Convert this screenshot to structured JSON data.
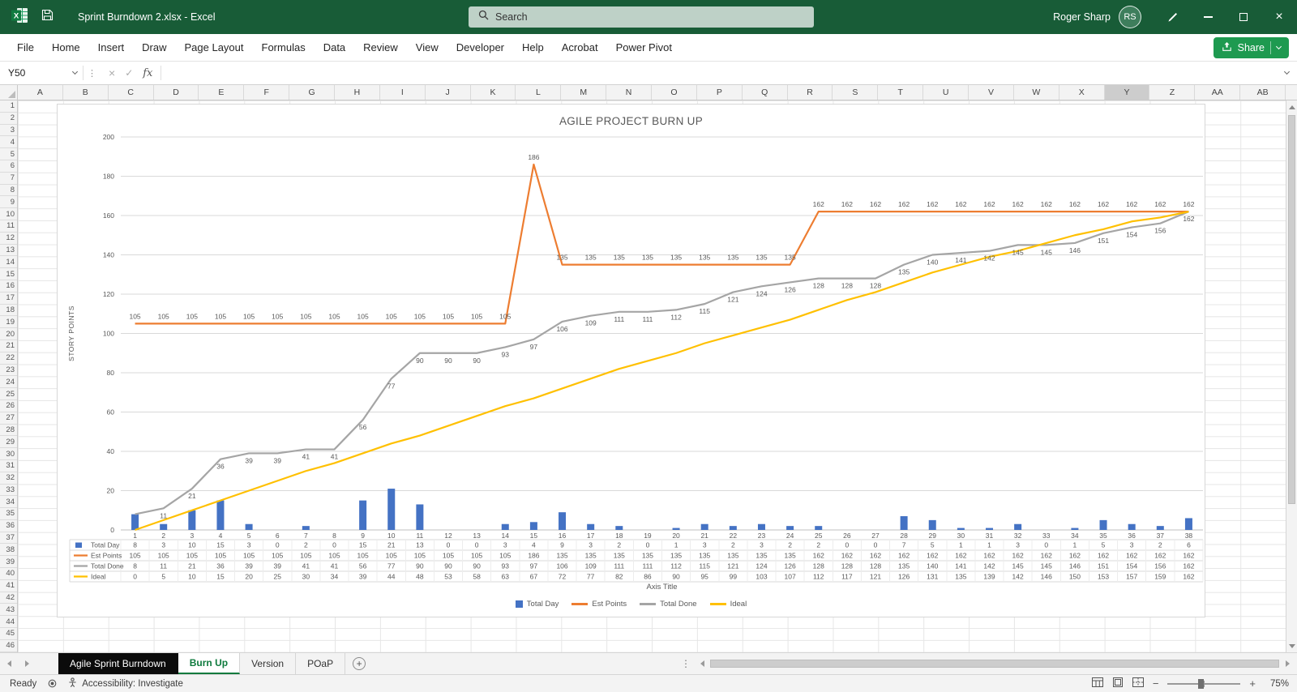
{
  "colors": {
    "titlebar_green": "#185C37",
    "accent_green": "#107C41",
    "share_button_green": "#1E9A50",
    "active_tab_green": "#0E7A3D"
  },
  "title_bar": {
    "document_title": "Sprint Burndown 2.xlsx - Excel",
    "search_placeholder": "Search",
    "user_name": "Roger Sharp",
    "user_initials": "RS"
  },
  "icons": {
    "close": "×",
    "cancel": "×",
    "confirm": "✓",
    "function": "fx",
    "dots": "⋮",
    "new_sheet": "+",
    "zoom_out": "−",
    "zoom_in": "+"
  },
  "ribbon": {
    "tabs": [
      "File",
      "Home",
      "Insert",
      "Draw",
      "Page Layout",
      "Formulas",
      "Data",
      "Review",
      "View",
      "Developer",
      "Help",
      "Acrobat",
      "Power Pivot"
    ],
    "share_label": "Share"
  },
  "formula_bar": {
    "name_box": "Y50",
    "formula_value": ""
  },
  "grid": {
    "columns": [
      "A",
      "B",
      "C",
      "D",
      "E",
      "F",
      "G",
      "H",
      "I",
      "J",
      "K",
      "L",
      "M",
      "N",
      "O",
      "P",
      "Q",
      "R",
      "S",
      "T",
      "U",
      "V",
      "W",
      "X",
      "Y",
      "Z",
      "AA",
      "AB"
    ],
    "selected_column": "Y",
    "rows_start": 1,
    "rows_end": 46
  },
  "sheet_tabs": {
    "tabs": [
      {
        "label": "Agile Sprint Burndown",
        "active": false,
        "dark": true
      },
      {
        "label": "Burn Up",
        "active": true,
        "dark": false
      },
      {
        "label": "Version",
        "active": false,
        "dark": false
      },
      {
        "label": "POaP",
        "active": false,
        "dark": false
      }
    ]
  },
  "status_bar": {
    "ready_label": "Ready",
    "accessibility_label": "Accessibility: Investigate",
    "zoom_level": "75%"
  },
  "chart_data": {
    "type": "combo",
    "title": "AGILE PROJECT BURN UP",
    "xlabel": "Axis Title",
    "ylabel": "STORY POINTS",
    "ylim": [
      0,
      200
    ],
    "ytick_step": 20,
    "gridlines": true,
    "legend_position": "bottom",
    "data_table": true,
    "categories": [
      1,
      2,
      3,
      4,
      5,
      6,
      7,
      8,
      9,
      10,
      11,
      12,
      13,
      14,
      15,
      16,
      17,
      18,
      19,
      20,
      21,
      22,
      23,
      24,
      25,
      26,
      27,
      28,
      29,
      30,
      31,
      32,
      33,
      34,
      35,
      36,
      37,
      38
    ],
    "series": [
      {
        "name": "Total Day",
        "type": "bar",
        "color": "#4472C4",
        "show_labels": false,
        "values": [
          8,
          3,
          10,
          15,
          3,
          0,
          2,
          0,
          15,
          21,
          13,
          0,
          0,
          3,
          4,
          9,
          3,
          2,
          0,
          1,
          3,
          2,
          3,
          2,
          2,
          0,
          0,
          7,
          5,
          1,
          1,
          3,
          0,
          1,
          5,
          3,
          2,
          6
        ]
      },
      {
        "name": "Est Points",
        "type": "line",
        "color": "#ED7D31",
        "show_labels": true,
        "label_position": "above",
        "values": [
          105,
          105,
          105,
          105,
          105,
          105,
          105,
          105,
          105,
          105,
          105,
          105,
          105,
          105,
          186,
          135,
          135,
          135,
          135,
          135,
          135,
          135,
          135,
          135,
          162,
          162,
          162,
          162,
          162,
          162,
          162,
          162,
          162,
          162,
          162,
          162,
          162,
          162
        ]
      },
      {
        "name": "Total Done",
        "type": "line",
        "color": "#A5A5A5",
        "show_labels": true,
        "label_position": "below",
        "label_skip_first": true,
        "values": [
          8,
          11,
          21,
          36,
          39,
          39,
          41,
          41,
          56,
          77,
          90,
          90,
          90,
          93,
          97,
          106,
          109,
          111,
          111,
          112,
          115,
          121,
          124,
          126,
          128,
          128,
          128,
          135,
          140,
          141,
          142,
          145,
          145,
          146,
          151,
          154,
          156,
          162
        ]
      },
      {
        "name": "Ideal",
        "type": "line",
        "color": "#FFC000",
        "show_labels": false,
        "values": [
          0,
          5,
          10,
          15,
          20,
          25,
          30,
          34,
          39,
          44,
          48,
          53,
          58,
          63,
          67,
          72,
          77,
          82,
          86,
          90,
          95,
          99,
          103,
          107,
          112,
          117,
          121,
          126,
          131,
          135,
          139,
          142,
          146,
          150,
          153,
          157,
          159,
          162
        ]
      }
    ]
  }
}
